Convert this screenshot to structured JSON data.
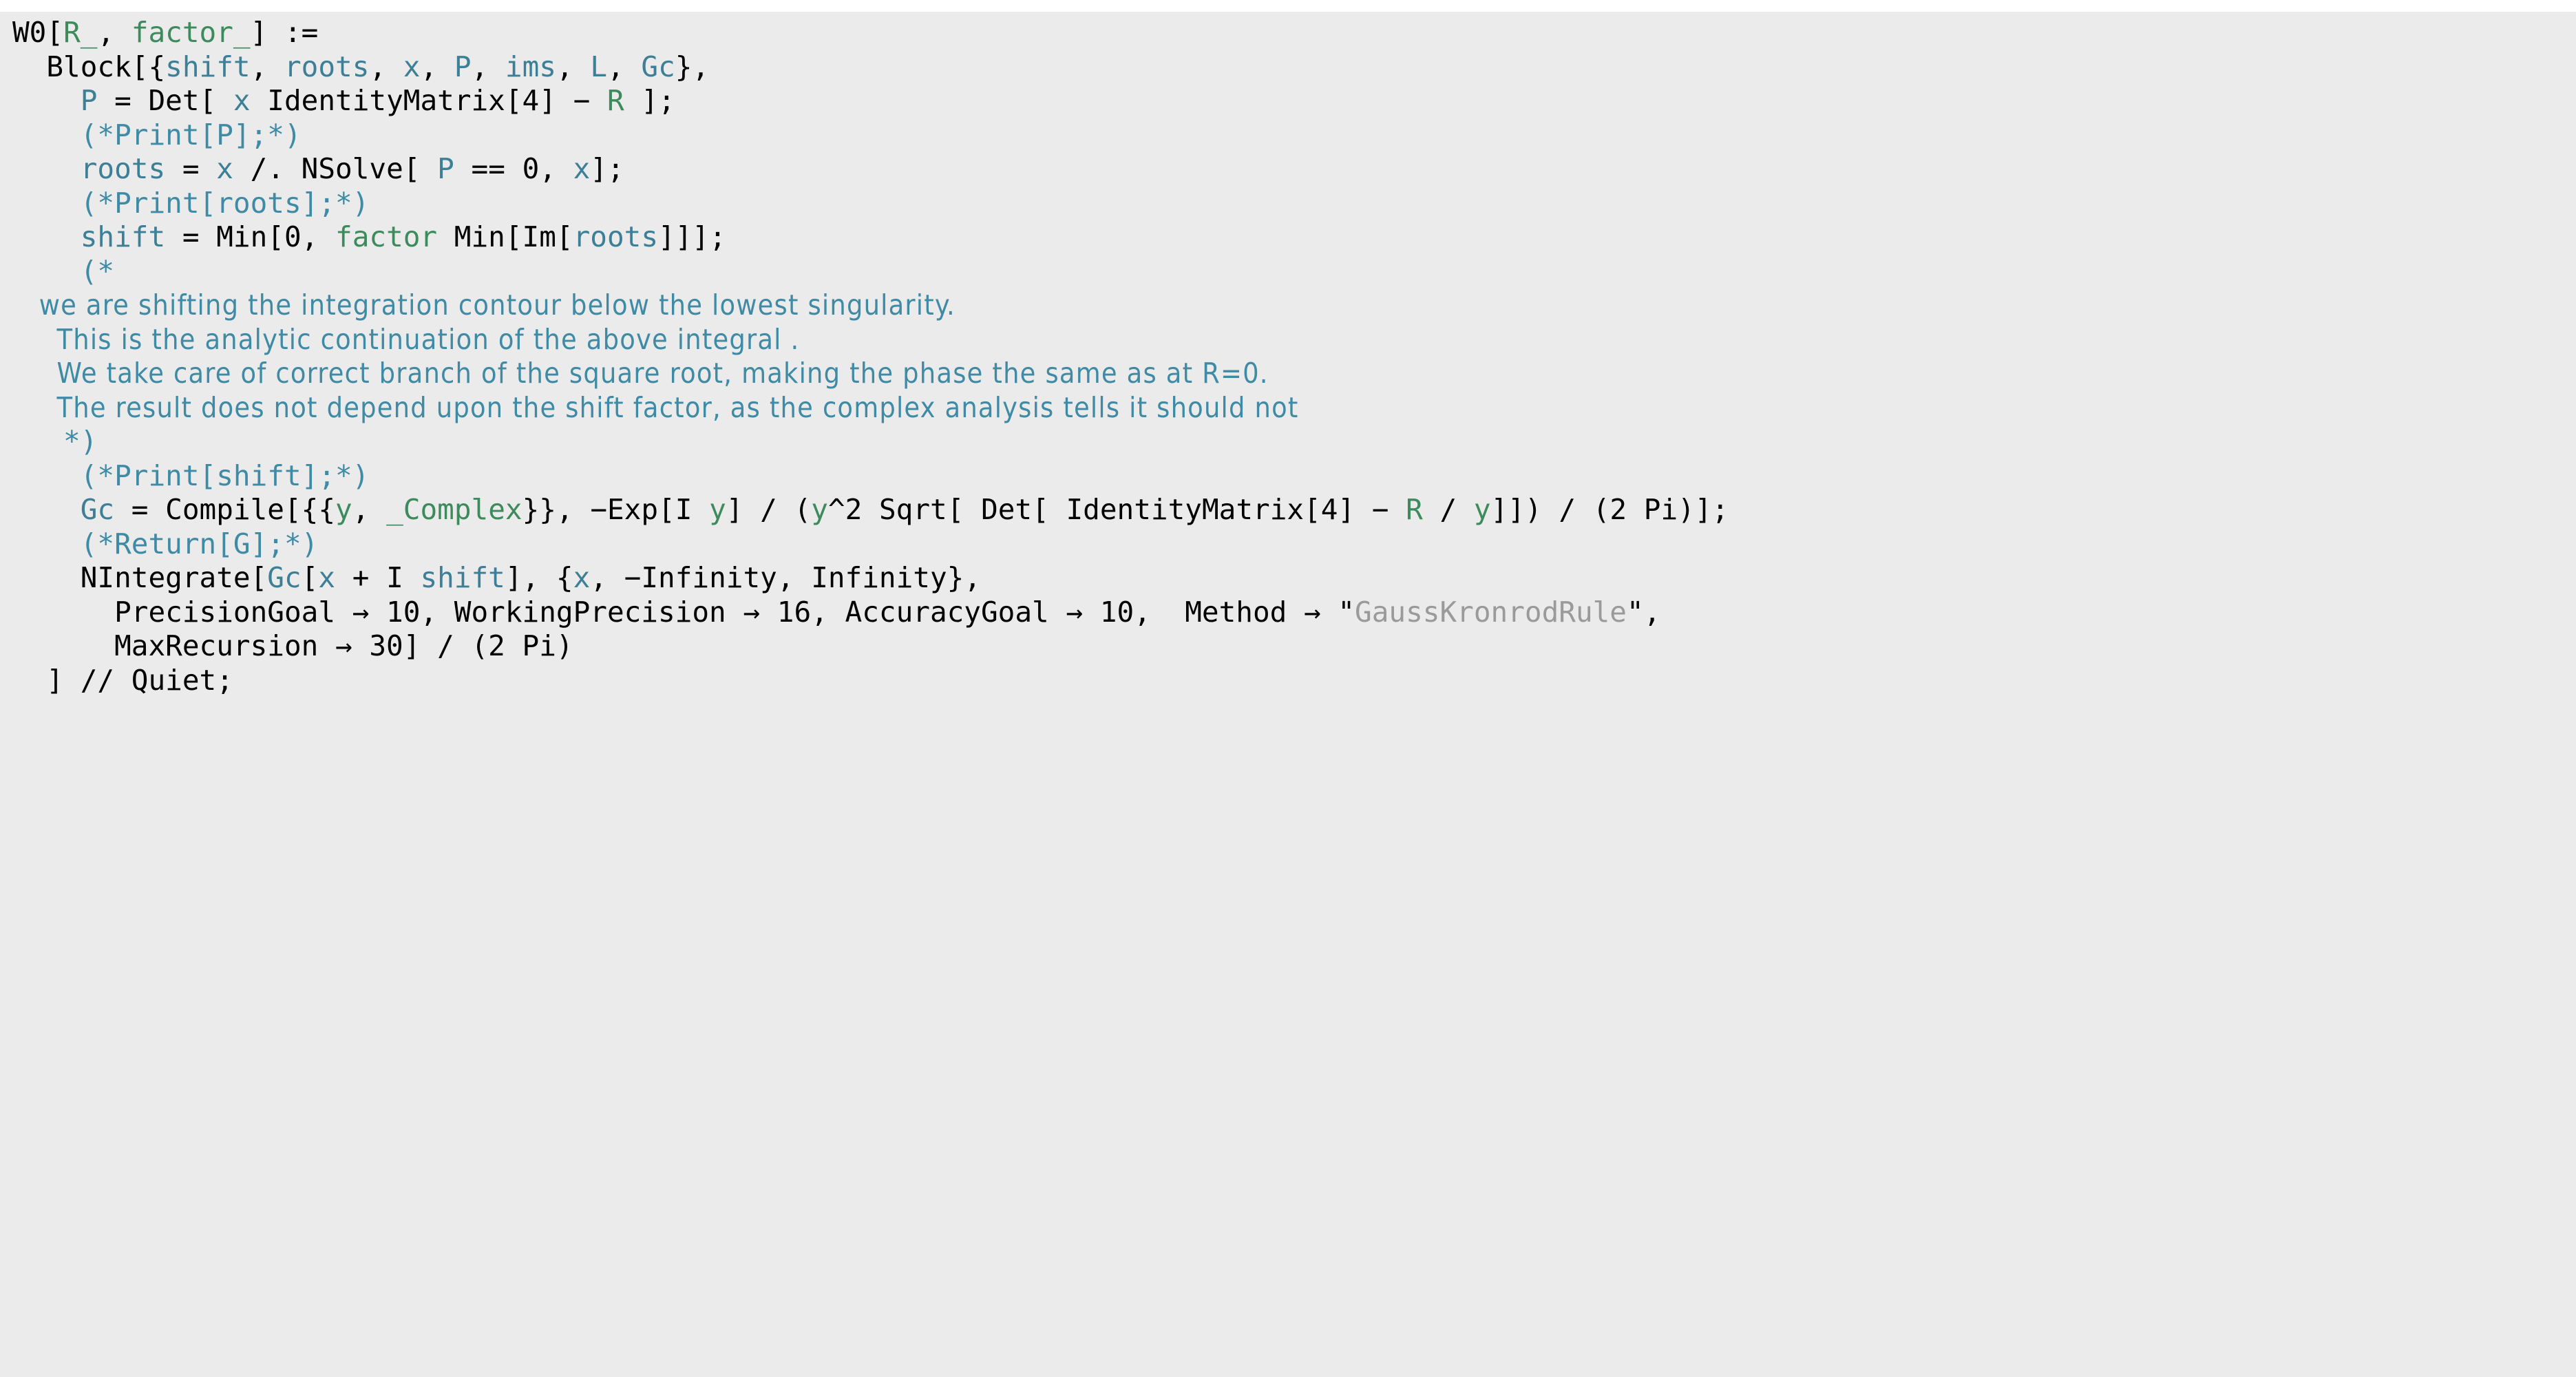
{
  "app": {
    "kind": "wolfram-notebook-code-cell",
    "background_color": "#ebebeb",
    "page_background_color": "#ffffff"
  },
  "colors": {
    "builtin": "#000000",
    "local_variable": "#3c7f96",
    "pattern_parameter": "#3d8a5d",
    "comment": "#3f8ba6",
    "string": "#9a9a9a"
  },
  "code": {
    "language": "Wolfram Language",
    "function_name": "W0",
    "full_text": "W0[R_, factor_] :=\n  Block[{shift, roots, x, P, ims, L, Gc},\n    P = Det[ x IdentityMatrix[4] - R ];\n    (*Print[P];*)\n    roots = x /. NSolve[ P == 0, x];\n    (*Print[roots];*)\n    shift = Min[0, factor Min[Im[roots]]];\n    (*\n   we are shifting the integration contour below the lowest singularity.\n     This is the analytic continuation of the above integral .\n     We take care of correct branch of the square root, making the phase the same as at R=0.\n     The result does not depend upon the shift factor, as the complex analysis tells it should not\n   *)\n    (*Print[shift];*)\n    Gc = Compile[{{y, _Complex}}, -Exp[I y] / (y^2 Sqrt[ Det[ IdentityMatrix[4] - R / y]]) / (2 Pi)];\n    (*Return[G];*)\n    NIntegrate[Gc[x + I shift], {x, -Infinity, Infinity},\n      PrecisionGoal -> 10, WorkingPrecision -> 16, AccuracyGoal -> 10,  Method -> \"GaussKronrodRule\",\n      MaxRecursion -> 30] / (2 Pi)\n  ] // Quiet;",
    "lines": [
      {
        "id": "line-1",
        "indent": 0,
        "tokens": [
          {
            "t": "W0[",
            "c": "sym"
          },
          {
            "t": "R_",
            "c": "par"
          },
          {
            "t": ", ",
            "c": "sym"
          },
          {
            "t": "factor_",
            "c": "par"
          },
          {
            "t": "] :=",
            "c": "sym"
          }
        ]
      },
      {
        "id": "line-2",
        "indent": 0,
        "tokens": [
          {
            "t": "  Block[{",
            "c": "sym"
          },
          {
            "t": "shift",
            "c": "loc"
          },
          {
            "t": ", ",
            "c": "sym"
          },
          {
            "t": "roots",
            "c": "loc"
          },
          {
            "t": ", ",
            "c": "sym"
          },
          {
            "t": "x",
            "c": "loc"
          },
          {
            "t": ", ",
            "c": "sym"
          },
          {
            "t": "P",
            "c": "loc"
          },
          {
            "t": ", ",
            "c": "sym"
          },
          {
            "t": "ims",
            "c": "loc"
          },
          {
            "t": ", ",
            "c": "sym"
          },
          {
            "t": "L",
            "c": "loc"
          },
          {
            "t": ", ",
            "c": "sym"
          },
          {
            "t": "Gc",
            "c": "loc"
          },
          {
            "t": "},",
            "c": "sym"
          }
        ]
      },
      {
        "id": "line-3",
        "indent": 0,
        "tokens": [
          {
            "t": "    ",
            "c": "sym"
          },
          {
            "t": "P",
            "c": "loc"
          },
          {
            "t": " = Det[ ",
            "c": "sym"
          },
          {
            "t": "x",
            "c": "loc"
          },
          {
            "t": " IdentityMatrix[4] − ",
            "c": "sym"
          },
          {
            "t": "R",
            "c": "par"
          },
          {
            "t": " ];",
            "c": "sym"
          }
        ]
      },
      {
        "id": "line-4",
        "indent": 0,
        "comment": true,
        "tokens": [
          {
            "t": "    (*Print[P];*)",
            "c": "cmt"
          }
        ]
      },
      {
        "id": "line-5",
        "indent": 0,
        "tokens": [
          {
            "t": "    ",
            "c": "sym"
          },
          {
            "t": "roots",
            "c": "loc"
          },
          {
            "t": " = ",
            "c": "sym"
          },
          {
            "t": "x",
            "c": "loc"
          },
          {
            "t": " /. NSolve[ ",
            "c": "sym"
          },
          {
            "t": "P",
            "c": "loc"
          },
          {
            "t": " == 0, ",
            "c": "sym"
          },
          {
            "t": "x",
            "c": "loc"
          },
          {
            "t": "];",
            "c": "sym"
          }
        ]
      },
      {
        "id": "line-6",
        "indent": 0,
        "comment": true,
        "tokens": [
          {
            "t": "    (*Print[roots];*)",
            "c": "cmt"
          }
        ]
      },
      {
        "id": "line-7",
        "indent": 0,
        "tokens": [
          {
            "t": "    ",
            "c": "sym"
          },
          {
            "t": "shift",
            "c": "loc"
          },
          {
            "t": " = Min[0, ",
            "c": "sym"
          },
          {
            "t": "factor",
            "c": "par"
          },
          {
            "t": " Min[Im[",
            "c": "sym"
          },
          {
            "t": "roots",
            "c": "loc"
          },
          {
            "t": "]]];",
            "c": "sym"
          }
        ]
      },
      {
        "id": "line-8",
        "indent": 0,
        "comment": true,
        "tokens": [
          {
            "t": "    (*",
            "c": "cmt"
          }
        ]
      },
      {
        "id": "line-9",
        "indent": 0,
        "comment": true,
        "prose": true,
        "tokens": [
          {
            "t": "   we are shifting the integration contour below the lowest singularity.",
            "c": "cmt-prose"
          }
        ]
      },
      {
        "id": "line-10",
        "indent": 0,
        "comment": true,
        "prose": true,
        "tokens": [
          {
            "t": "     This is the analytic continuation of the above integral .",
            "c": "cmt-prose"
          }
        ]
      },
      {
        "id": "line-11",
        "indent": 0,
        "comment": true,
        "prose": true,
        "tokens": [
          {
            "t": "     We take care of correct branch of the square root, making the phase the same as at R=0.",
            "c": "cmt-prose"
          }
        ]
      },
      {
        "id": "line-12",
        "indent": 0,
        "comment": true,
        "prose": true,
        "tokens": [
          {
            "t": "     The result does not depend upon the shift factor, as the complex analysis tells it should not",
            "c": "cmt-prose"
          }
        ]
      },
      {
        "id": "line-13",
        "indent": 0,
        "comment": true,
        "tokens": [
          {
            "t": "   *)",
            "c": "cmt"
          }
        ]
      },
      {
        "id": "line-14",
        "indent": 0,
        "comment": true,
        "tokens": [
          {
            "t": "    (*Print[shift];*)",
            "c": "cmt"
          }
        ]
      },
      {
        "id": "line-15",
        "indent": 0,
        "tokens": [
          {
            "t": "    ",
            "c": "sym"
          },
          {
            "t": "Gc",
            "c": "loc"
          },
          {
            "t": " = Compile[{{",
            "c": "sym"
          },
          {
            "t": "y",
            "c": "par"
          },
          {
            "t": ", ",
            "c": "sym"
          },
          {
            "t": "_Complex",
            "c": "par"
          },
          {
            "t": "}}, −Exp[I ",
            "c": "sym"
          },
          {
            "t": "y",
            "c": "par"
          },
          {
            "t": "] / (",
            "c": "sym"
          },
          {
            "t": "y",
            "c": "par"
          },
          {
            "t": "^2 Sqrt[ Det[ IdentityMatrix[4] − ",
            "c": "sym"
          },
          {
            "t": "R",
            "c": "par"
          },
          {
            "t": " / ",
            "c": "sym"
          },
          {
            "t": "y",
            "c": "par"
          },
          {
            "t": "]]) / (2 Pi)];",
            "c": "sym"
          }
        ]
      },
      {
        "id": "line-16",
        "indent": 0,
        "comment": true,
        "tokens": [
          {
            "t": "    (*Return[G];*)",
            "c": "cmt"
          }
        ]
      },
      {
        "id": "line-17",
        "indent": 0,
        "tokens": [
          {
            "t": "    NIntegrate[",
            "c": "sym"
          },
          {
            "t": "Gc",
            "c": "loc"
          },
          {
            "t": "[",
            "c": "sym"
          },
          {
            "t": "x",
            "c": "loc"
          },
          {
            "t": " + I ",
            "c": "sym"
          },
          {
            "t": "shift",
            "c": "loc"
          },
          {
            "t": "], {",
            "c": "sym"
          },
          {
            "t": "x",
            "c": "loc"
          },
          {
            "t": ", −Infinity, Infinity},",
            "c": "sym"
          }
        ]
      },
      {
        "id": "line-18",
        "indent": 0,
        "tokens": [
          {
            "t": "      PrecisionGoal → 10, WorkingPrecision → 16, AccuracyGoal → 10,  Method → ",
            "c": "sym"
          },
          {
            "t": "\"",
            "c": "sym"
          },
          {
            "t": "GaussKronrodRule",
            "c": "str"
          },
          {
            "t": "\",",
            "c": "sym"
          }
        ]
      },
      {
        "id": "line-19",
        "indent": 0,
        "tokens": [
          {
            "t": "      MaxRecursion → 30] / (2 Pi)",
            "c": "sym"
          }
        ]
      },
      {
        "id": "line-20",
        "indent": 0,
        "tokens": [
          {
            "t": "  ] // Quiet;",
            "c": "sym"
          }
        ]
      }
    ]
  }
}
